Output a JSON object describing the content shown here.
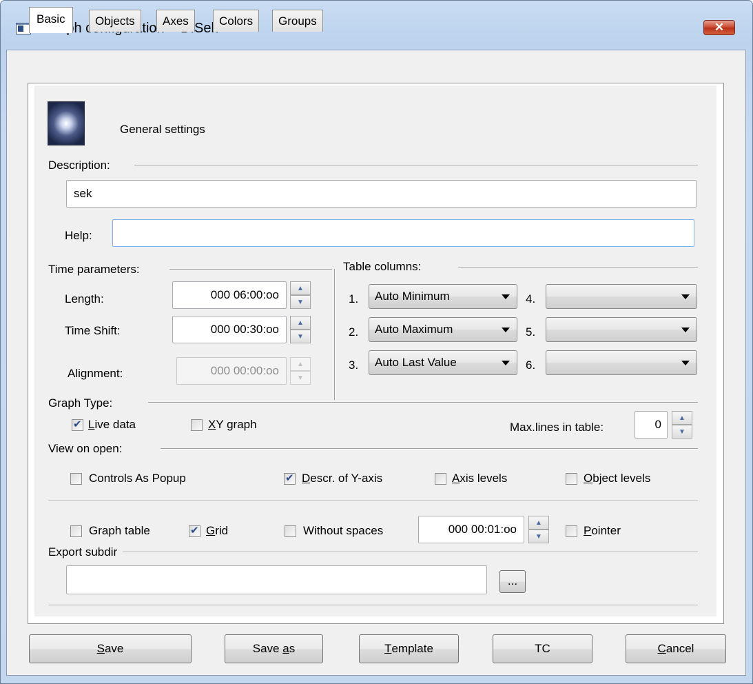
{
  "window": {
    "title": "Graph configuration -  D.Sek",
    "close_label": "✕"
  },
  "tabs": [
    {
      "label": "Basic",
      "active": true
    },
    {
      "label": "Objects",
      "active": false
    },
    {
      "label": "Axes",
      "active": false
    },
    {
      "label": "Colors",
      "active": false
    },
    {
      "label": "Groups",
      "active": false
    }
  ],
  "header": {
    "icon": "graph-settings-icon",
    "text": "General settings"
  },
  "description": {
    "label": "Description:",
    "value": "sek"
  },
  "help": {
    "label": "Help:",
    "value": ""
  },
  "time_parameters": {
    "label": "Time parameters:",
    "length": {
      "label": "Length:",
      "value": "000 06:00:oo"
    },
    "time_shift": {
      "label": "Time Shift:",
      "value": "000 00:30:oo"
    },
    "alignment": {
      "label": "Alignment:",
      "value": "000 00:00:oo"
    }
  },
  "table_columns": {
    "label": "Table columns:",
    "items": [
      {
        "num": "1.",
        "value": "Auto Minimum"
      },
      {
        "num": "2.",
        "value": "Auto Maximum"
      },
      {
        "num": "3.",
        "value": "Auto Last Value"
      },
      {
        "num": "4.",
        "value": ""
      },
      {
        "num": "5.",
        "value": ""
      },
      {
        "num": "6.",
        "value": ""
      }
    ]
  },
  "graph_type": {
    "label": "Graph Type:",
    "live_data": {
      "pre": "",
      "u": "L",
      "post": "ive data",
      "checked": true
    },
    "xy_graph": {
      "pre": "",
      "u": "X",
      "post": "Y graph",
      "checked": false
    },
    "max_lines_label": "Max.lines in table:",
    "max_lines_value": "0"
  },
  "view_on_open": {
    "label": "View on open:",
    "controls_popup": {
      "label": "Controls As Popup",
      "checked": false
    },
    "descr_y_axis": {
      "pre": "",
      "u": "D",
      "post": "escr. of Y-axis",
      "checked": true
    },
    "axis_levels": {
      "pre": "",
      "u": "A",
      "post": "xis levels",
      "checked": false
    },
    "object_levels": {
      "pre": "",
      "u": "O",
      "post": "bject levels",
      "checked": false
    }
  },
  "options": {
    "graph_table": {
      "label": "Graph table",
      "checked": false
    },
    "grid": {
      "pre": "",
      "u": "G",
      "post": "rid",
      "checked": true
    },
    "without_spaces": {
      "label": "Without spaces",
      "checked": false
    },
    "interval_value": "000 00:01:oo",
    "pointer": {
      "pre": "",
      "u": "P",
      "post": "ointer",
      "checked": false
    }
  },
  "export": {
    "label": "Export subdir",
    "value": "",
    "browse_label": "..."
  },
  "buttons": {
    "save": {
      "pre": "",
      "u": "S",
      "post": "ave"
    },
    "save_as": {
      "pre": "Save ",
      "u": "a",
      "post": "s"
    },
    "template": {
      "pre": "",
      "u": "T",
      "post": "emplate"
    },
    "tc": {
      "label": "TC"
    },
    "cancel": {
      "pre": "",
      "u": "C",
      "post": "ancel"
    }
  }
}
